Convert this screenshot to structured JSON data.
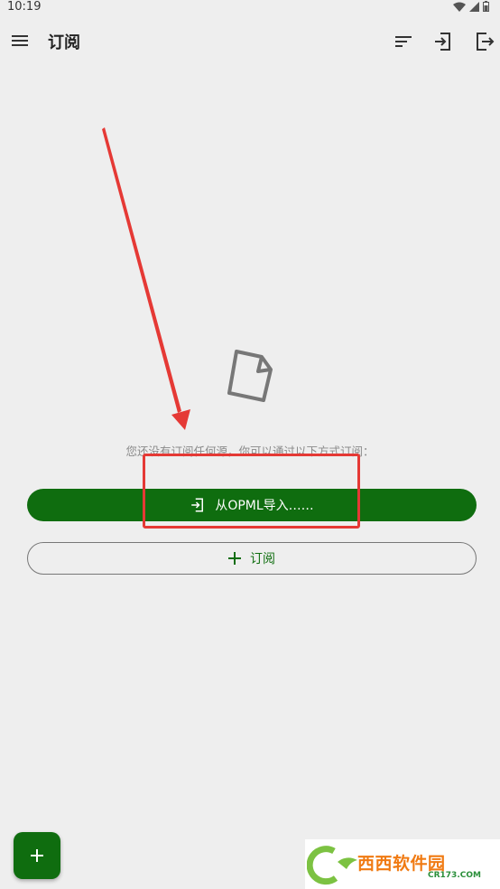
{
  "status_bar": {
    "time": "10:19"
  },
  "app_bar": {
    "title": "订阅"
  },
  "empty_state": {
    "message": "您还没有订阅任何源，你可以通过以下方式订阅："
  },
  "buttons": {
    "import_label": "从OPML导入……",
    "subscribe_label": "订阅"
  },
  "fab": {
    "label": "+"
  },
  "watermark": {
    "text": "西西软件园",
    "sub": "CR173.COM"
  },
  "colors": {
    "primary": "#0f6d0f",
    "annotation": "#e53935",
    "background": "#eeeeee"
  }
}
